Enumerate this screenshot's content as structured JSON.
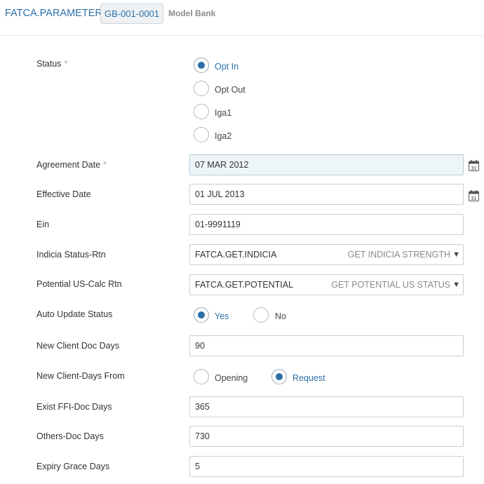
{
  "header": {
    "app_title": "FATCA.PARAMETER",
    "record_id": "GB-001-0001",
    "company": "Model Bank"
  },
  "form": {
    "status": {
      "label": "Status",
      "required": "*",
      "options": [
        "Opt In",
        "Opt Out",
        "Iga1",
        "Iga2"
      ],
      "selected": "Opt In"
    },
    "agreement_date": {
      "label": "Agreement Date",
      "required": "*",
      "value": "07 MAR 2012",
      "calendar_day": "31"
    },
    "effective_date": {
      "label": "Effective Date",
      "value": "01 JUL 2013",
      "calendar_day": "31"
    },
    "ein": {
      "label": "Ein",
      "value": "01-9991119"
    },
    "indicia_status_rtn": {
      "label": "Indicia Status-Rtn",
      "value": "FATCA.GET.INDICIA",
      "description": "GET INDICIA STRENGTH"
    },
    "potential_us_calc_rtn": {
      "label": "Potential US-Calc Rtn",
      "value": "FATCA.GET.POTENTIAL",
      "description": "GET POTENTIAL US STATUS"
    },
    "auto_update_status": {
      "label": "Auto Update Status",
      "options": [
        "Yes",
        "No"
      ],
      "selected": "Yes"
    },
    "new_client_doc_days": {
      "label": "New Client Doc Days",
      "value": "90"
    },
    "new_client_days_from": {
      "label": "New Client-Days From",
      "options": [
        "Opening",
        "Request"
      ],
      "selected": "Request"
    },
    "exist_ffi_doc_days": {
      "label": "Exist FFI-Doc Days",
      "value": "365"
    },
    "others_doc_days": {
      "label": "Others-Doc Days",
      "value": "730"
    },
    "expiry_grace_days": {
      "label": "Expiry Grace Days",
      "value": "5"
    }
  },
  "icons": {
    "calendar": "calendar-icon",
    "dropdown": "triangle-down-icon"
  },
  "colors": {
    "accent": "#2b6fa8",
    "field_highlight": "#eef5f9",
    "label": "#333333"
  }
}
